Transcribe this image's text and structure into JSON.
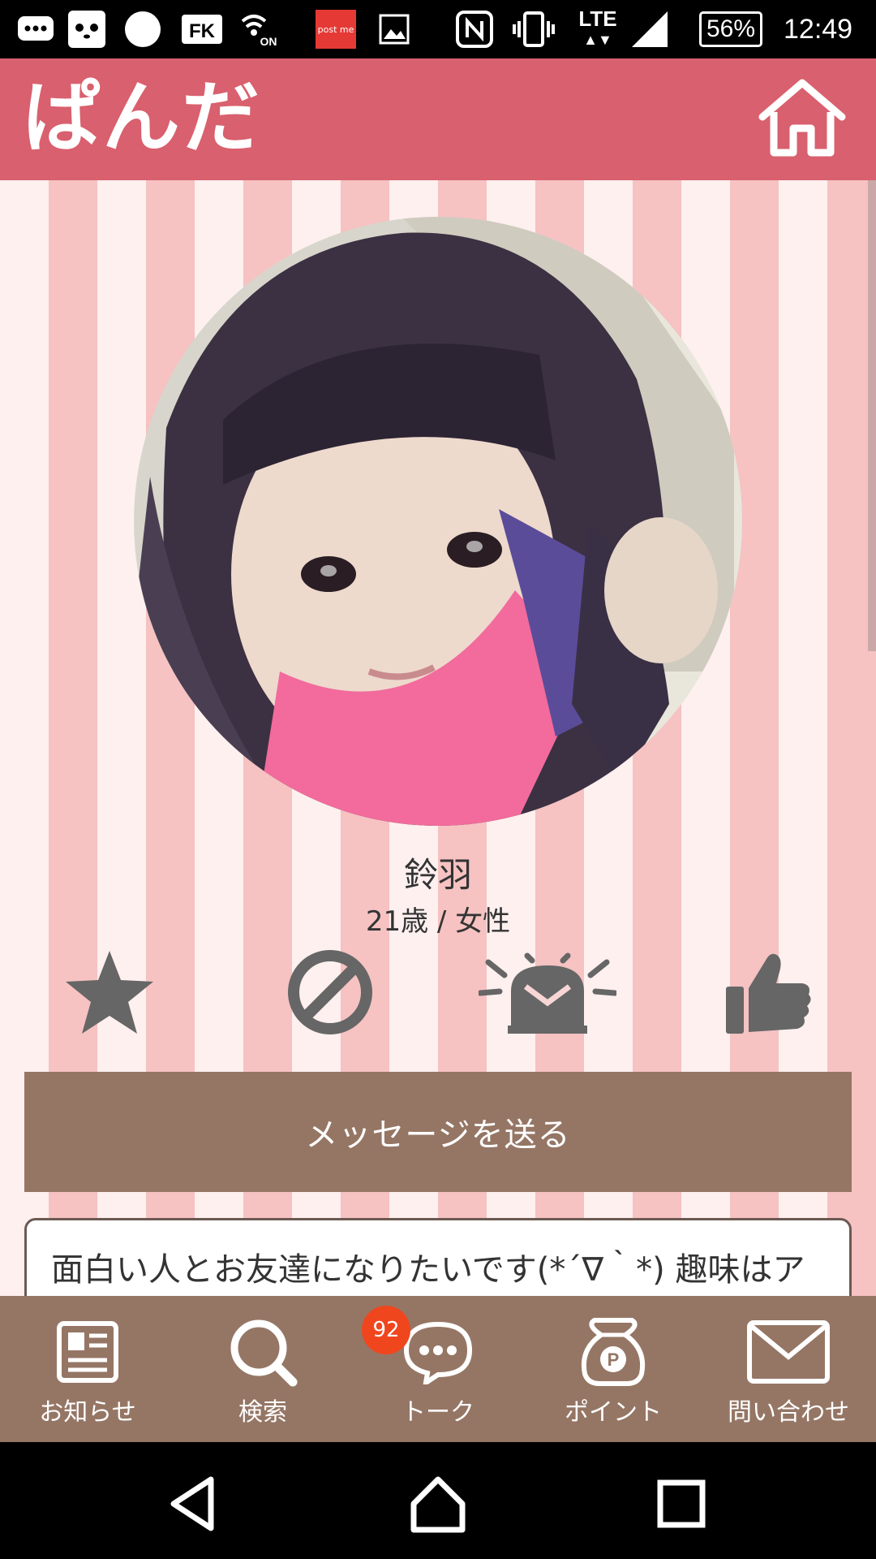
{
  "status_bar": {
    "postme_label": "post me",
    "network": "LTE",
    "battery": "56%",
    "time": "12:49",
    "icons": [
      "chat-bubble-icon",
      "panda-icon",
      "circle-icon",
      "fk-icon",
      "wifi-calling-icon",
      "postme-icon",
      "image-icon",
      "nfc-icon",
      "vibrate-icon",
      "signal-icon",
      "battery-icon"
    ]
  },
  "header": {
    "logo_text": "ぱんだ",
    "home_icon": "home-icon",
    "color": "#d9606e"
  },
  "profile": {
    "name": "鈴羽",
    "info": "21歳 / 女性",
    "actions": [
      {
        "icon": "star-icon"
      },
      {
        "icon": "block-icon"
      },
      {
        "icon": "alarm-report-icon"
      },
      {
        "icon": "thumbs-up-icon"
      }
    ],
    "message_button": "メッセージを送る",
    "intro": "面白い人とお友達になりたいです(*´∇｀*) 趣味はア"
  },
  "bottom_nav": {
    "items": [
      {
        "label": "お知らせ",
        "icon": "news-icon"
      },
      {
        "label": "検索",
        "icon": "search-icon"
      },
      {
        "label": "トーク",
        "icon": "talk-bubble-icon"
      },
      {
        "label": "ポイント",
        "icon": "point-bag-icon"
      },
      {
        "label": "問い合わせ",
        "icon": "mail-icon"
      }
    ],
    "talk_badge": "92",
    "color": "#957665"
  },
  "system_nav": {
    "icons": [
      "back-icon",
      "home-icon",
      "recents-icon"
    ]
  }
}
